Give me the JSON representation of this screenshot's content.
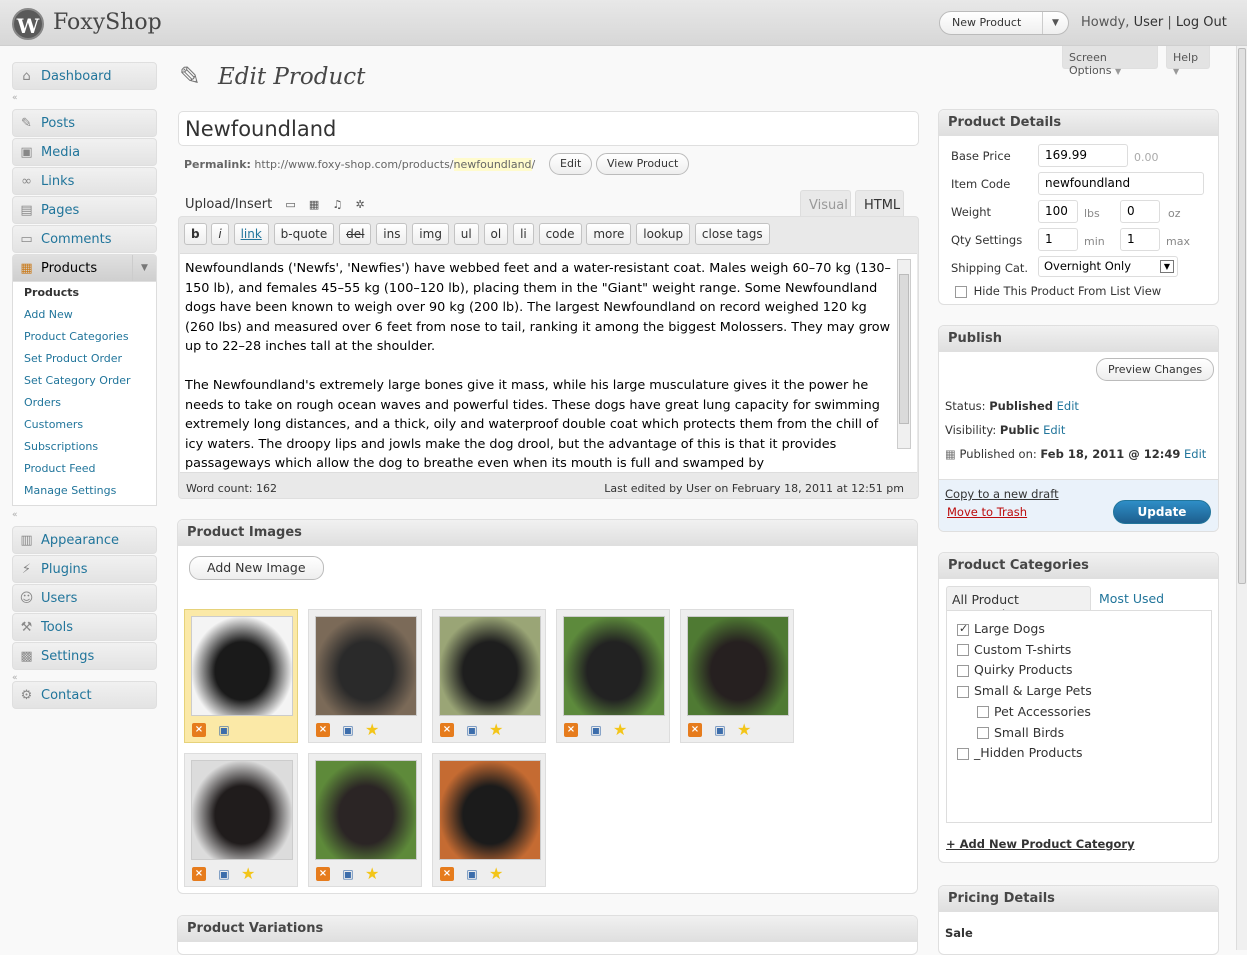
{
  "header": {
    "site_title": "FoxyShop",
    "favorite_action": "New Product",
    "howdy": "Howdy,",
    "user": "User",
    "separator": "|",
    "logout": "Log Out"
  },
  "screen_tabs": {
    "screen_options": "Screen Options",
    "help": "Help"
  },
  "menu": {
    "dashboard": "Dashboard",
    "posts": "Posts",
    "media": "Media",
    "links": "Links",
    "pages": "Pages",
    "comments": "Comments",
    "products": "Products",
    "products_sub": [
      "Products",
      "Add New",
      "Product Categories",
      "Set Product Order",
      "Set Category Order",
      "Orders",
      "Customers",
      "Subscriptions",
      "Product Feed",
      "Manage Settings"
    ],
    "appearance": "Appearance",
    "plugins": "Plugins",
    "users": "Users",
    "tools": "Tools",
    "settings": "Settings",
    "contact": "Contact"
  },
  "page": {
    "title": "Edit Product",
    "product_title": "Newfoundland",
    "permalink_label": "Permalink:",
    "permalink_base": "http://www.foxy-shop.com/products/",
    "permalink_slug": "newfoundland",
    "permalink_end": "/",
    "edit_btn": "Edit",
    "view_btn": "View Product"
  },
  "editor": {
    "upload_insert": "Upload/Insert",
    "tab_visual": "Visual",
    "tab_html": "HTML",
    "quicktags": [
      "b",
      "i",
      "link",
      "b-quote",
      "del",
      "ins",
      "img",
      "ul",
      "ol",
      "li",
      "code",
      "more",
      "lookup",
      "close tags"
    ],
    "paragraph1": "Newfoundlands ('Newfs', 'Newfies') have webbed feet and a water-resistant coat. Males weigh 60–70 kg (130–150 lb), and females 45–55 kg (100–120 lb), placing them in the \"Giant\" weight range. Some Newfoundland dogs have been known to weigh over 90 kg (200 lb). The largest Newfoundland on record weighed 120 kg (260 lbs) and measured over 6 feet from nose to tail, ranking it among the biggest Molossers. They may grow up to 22–28 inches tall at the shoulder.",
    "paragraph2": "The Newfoundland's extremely large bones give it mass, while his large musculature gives it the power he needs to take on rough ocean waves and powerful tides. These dogs have great lung capacity for swimming extremely long distances, and a thick, oily and waterproof double coat which protects them from the chill of icy waters. The droopy lips and jowls make the dog drool, but the advantage of this is that it provides passageways which allow the dog to breathe even when its mouth is full and swamped by",
    "word_count": "Word count: 162",
    "last_edited": "Last edited by User on February 18, 2011 at 12:51 pm"
  },
  "product_images": {
    "title": "Product Images",
    "add_button": "Add New Image",
    "images": [
      {
        "alt": "newfoundland-puppy",
        "bg": "#1a1a1a",
        "bg2": "#f4f4f4"
      },
      {
        "alt": "newfoundland-1",
        "bg": "#2a2a2a",
        "bg2": "#7b6a58"
      },
      {
        "alt": "newfoundland-2",
        "bg": "#1e1e1e",
        "bg2": "#9aa576"
      },
      {
        "alt": "newfoundland-3",
        "bg": "#222222",
        "bg2": "#5d8a3c"
      },
      {
        "alt": "newfoundland-4",
        "bg": "#262020",
        "bg2": "#4f7a33"
      },
      {
        "alt": "newfoundland-5",
        "bg": "#201c1c",
        "bg2": "#dcdcdc"
      },
      {
        "alt": "newfoundland-6",
        "bg": "#2b2525",
        "bg2": "#5e8a3a"
      },
      {
        "alt": "newfoundland-7",
        "bg": "#1b1b1b",
        "bg2": "#c56b32"
      }
    ]
  },
  "product_variations": {
    "title": "Product Variations"
  },
  "product_details": {
    "title": "Product Details",
    "base_price_label": "Base Price",
    "base_price": "169.99",
    "base_price_hint": "0.00",
    "item_code_label": "Item Code",
    "item_code": "newfoundland",
    "weight_label": "Weight",
    "weight_lbs": "100",
    "lbs": "lbs",
    "weight_oz": "0",
    "oz": "oz",
    "qty_label": "Qty Settings",
    "qty_min": "1",
    "min": "min",
    "qty_max": "1",
    "max": "max",
    "shipping_label": "Shipping Cat.",
    "shipping_value": "Overnight Only",
    "hide_label": "Hide This Product From List View"
  },
  "publish": {
    "title": "Publish",
    "preview": "Preview Changes",
    "status_label": "Status:",
    "status_value": "Published",
    "visibility_label": "Visibility:",
    "visibility_value": "Public",
    "published_label": "Published on:",
    "published_value": "Feb 18, 2011 @ 12:49",
    "edit": "Edit",
    "copy_draft": "Copy to a new draft",
    "trash": "Move to Trash",
    "update": "Update"
  },
  "categories": {
    "title": "Product Categories",
    "tab_all": "All Product Categories",
    "tab_most": "Most Used",
    "items": [
      {
        "label": "Large Dogs",
        "checked": true,
        "indent": false
      },
      {
        "label": "Custom T-shirts",
        "checked": false,
        "indent": false
      },
      {
        "label": "Quirky Products",
        "checked": false,
        "indent": false
      },
      {
        "label": "Small & Large Pets",
        "checked": false,
        "indent": false
      },
      {
        "label": "Pet Accessories",
        "checked": false,
        "indent": true
      },
      {
        "label": "Small Birds",
        "checked": false,
        "indent": true
      },
      {
        "label": "_Hidden Products",
        "checked": false,
        "indent": false
      }
    ],
    "add_new": "+ Add New Product Category"
  },
  "pricing": {
    "title": "Pricing Details",
    "sale": "Sale"
  }
}
